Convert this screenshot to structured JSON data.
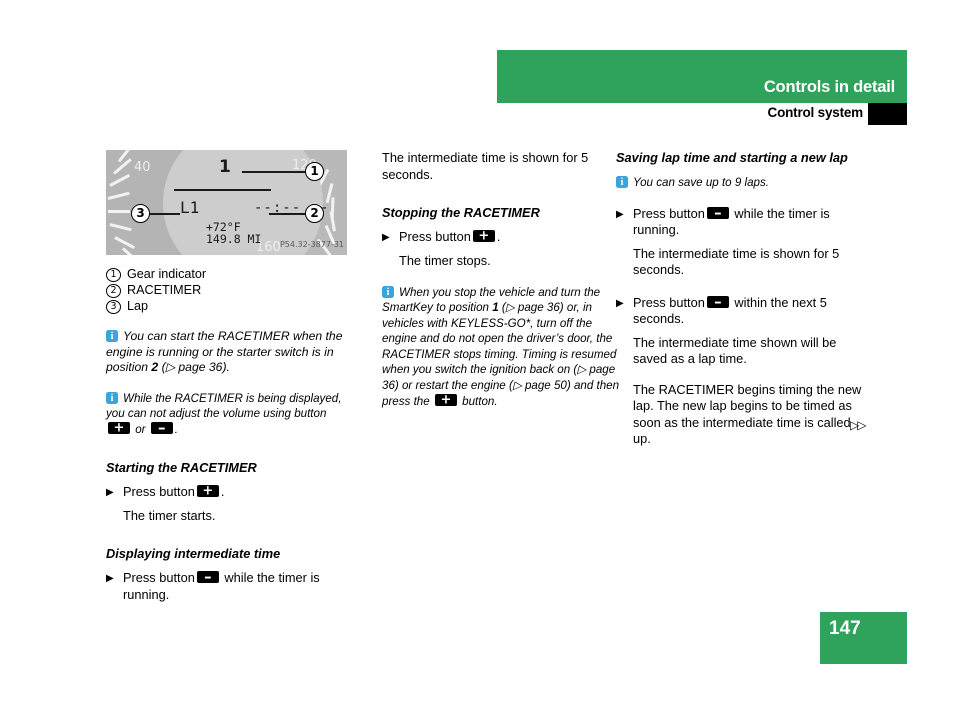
{
  "header": {
    "chapter_title": "Controls in detail",
    "section_title": "Control system"
  },
  "footer": {
    "page_number": "147"
  },
  "figure": {
    "gauge_numbers": {
      "left": "40",
      "right": "120",
      "bottom": "160"
    },
    "gear_value": "1",
    "lap_label": "L1",
    "timer_value": "--:-- --",
    "temperature": "+72°F",
    "odometer": "149.8 MI",
    "image_code": "P54.32-3877-31",
    "callouts": [
      "1",
      "2",
      "3"
    ],
    "legend": [
      {
        "num": "1",
        "label": "Gear indicator"
      },
      {
        "num": "2",
        "label": "RACETIMER"
      },
      {
        "num": "3",
        "label": "Lap"
      }
    ]
  },
  "column1": {
    "note1_part1": "You can start the RACETIMER when the engine is running or the starter switch is in position ",
    "note1_bold": "2",
    "note1_part2": " (▷ page 36).",
    "note2_part1": "While the RACETIMER is being displayed, you can not adjust the volume using button ",
    "note2_mid": " or ",
    "note2_end": ".",
    "heading_starting": "Starting the RACETIMER",
    "step_press_button": "Press button",
    "step_period": ".",
    "result_timer_starts": "The timer starts.",
    "heading_displaying": "Displaying intermediate time",
    "step_while_running": " while the timer is running."
  },
  "column2": {
    "intro_text": "The intermediate time is shown for 5 seconds.",
    "heading_stopping": "Stopping the RACETIMER",
    "step_press_button": "Press button",
    "step_period": ".",
    "result_timer_stops": "The timer stops.",
    "note_part1": "When you stop the vehicle and turn the SmartKey to position ",
    "note_bold": "1",
    "note_part2": " (▷ page 36) or, in vehicles with KEYLESS-GO*, turn off the engine and do not open the driver’s door, the RACETIMER stops timing. Timing is resumed when you switch the ignition back on (▷ page 36) or restart the engine (▷ page 50) and then press the ",
    "note_part3": " button."
  },
  "column3": {
    "heading_saving": "Saving lap time and starting a new lap",
    "note_laps": "You can save up to 9 laps.",
    "step1_press_button": "Press button",
    "step1_tail": " while the timer is running.",
    "result1": "The intermediate time is shown for 5 seconds.",
    "step2_press_button": "Press button",
    "step2_tail": " within the next 5 seconds.",
    "result2": "The intermediate time shown will be saved as a lap time.",
    "result3": "The RACETIMER begins timing the new lap. The new lap begins to be timed as soon as the intermediate time is called up.",
    "continuation_marker": "▷▷"
  },
  "colors": {
    "brand_green": "#2fa35b",
    "info_blue": "#3aa5dd",
    "button_black": "#000000"
  }
}
